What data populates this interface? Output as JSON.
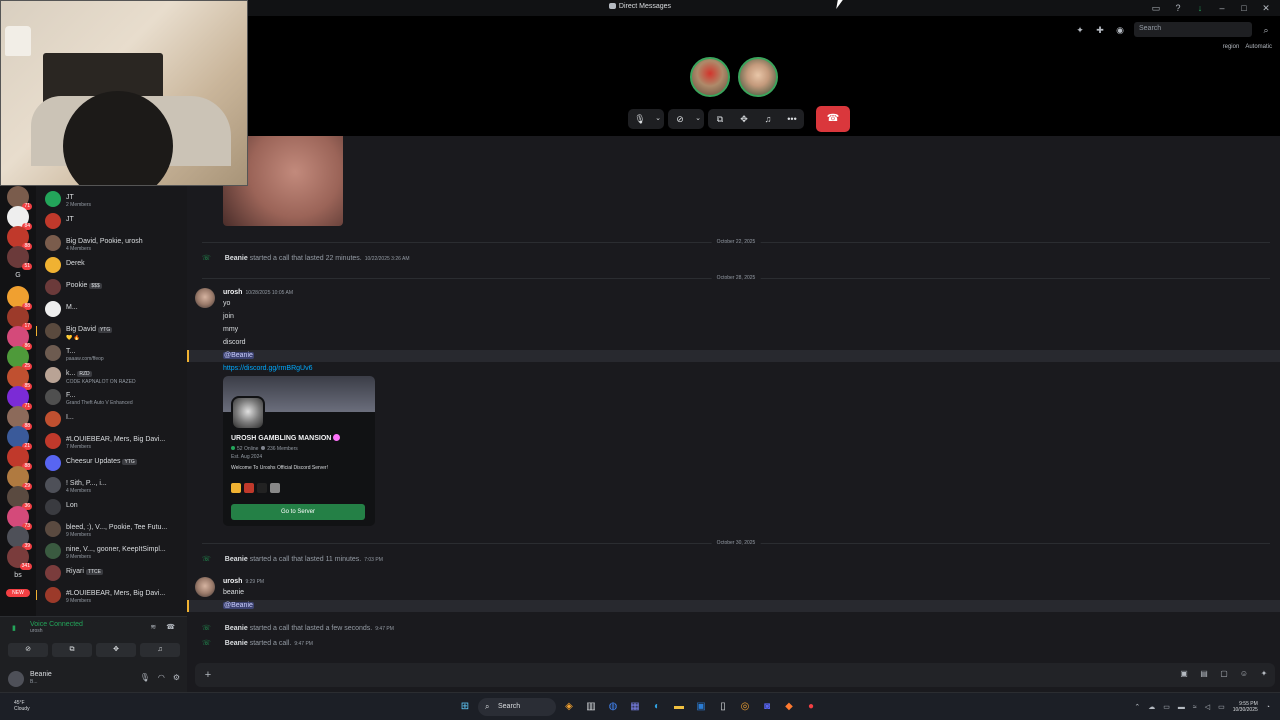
{
  "window": {
    "title": "Direct Messages",
    "search_placeholder": "Search",
    "region_label": "region",
    "region_value": "Automatic"
  },
  "call": {
    "controls": [
      "microphone-icon",
      "chevron-down-icon",
      "camera-off-icon",
      "chevron-down-icon",
      "screen-share-icon",
      "activity-icon",
      "soundboard-icon",
      "more-icon"
    ],
    "end_icon": "phone-hangup-icon"
  },
  "rail": {
    "badges": [
      "71",
      "84",
      "88",
      "51",
      "88",
      "17",
      "86",
      "25",
      "85",
      "71",
      "88",
      "21",
      "88",
      "29",
      "36",
      "73",
      "39",
      "341",
      "81"
    ],
    "letter_items": [
      "G",
      "bs"
    ],
    "new_label": "NEW"
  },
  "dms": [
    {
      "name": "JT",
      "sub": "2 Members",
      "color": "#23a55a"
    },
    {
      "name": "JT",
      "sub": "",
      "color": "#c0392b"
    },
    {
      "name": "Big David, Pookie, urosh",
      "sub": "4 Members",
      "color": "#7a5c4c"
    },
    {
      "name": "Derek",
      "sub": "",
      "color": "#f0b232"
    },
    {
      "name": "Pookie",
      "sub": "",
      "tag": "$$$",
      "color": "#6b3a3a"
    },
    {
      "name": "M...",
      "sub": "",
      "color": "#eeeeee"
    },
    {
      "name": "Big David",
      "sub": "💛 🔥",
      "tag": "YTG",
      "color": "#5a4a3e",
      "unread": true
    },
    {
      "name": "T...",
      "sub": "paaaw.com/ffeop",
      "color": "#6d5b50"
    },
    {
      "name": "k...",
      "sub": "CODE KAPNALOT ON RAZED",
      "tag": "RZD",
      "color": "#b9a395"
    },
    {
      "name": "F...",
      "sub": "Grand Theft Auto V Enhanced",
      "color": "#4f4f4f"
    },
    {
      "name": "I...",
      "sub": "",
      "color": "#c05030"
    },
    {
      "name": "#LOUIEBEAR, Mers, Big Davi...",
      "sub": "7 Members",
      "color": "#c0392b"
    },
    {
      "name": "Cheesur Updates",
      "sub": "",
      "tag": "YTG",
      "color": "#5865f2"
    },
    {
      "name": "! Sith, P..., i...",
      "sub": "4 Members",
      "color": "#4e5058"
    },
    {
      "name": "Lon",
      "sub": "",
      "color": "#3a3b40"
    },
    {
      "name": "bleed, :), V..., Pookie, Tee Futu...",
      "sub": "9 Members",
      "color": "#5a4a40"
    },
    {
      "name": "nine, V..., gooner, KeepItSimpl...",
      "sub": "9 Members",
      "color": "#3a5a40"
    },
    {
      "name": "Riyari",
      "sub": "",
      "tag": "TTCE",
      "color": "#7a3c3c"
    },
    {
      "name": "#LOUIEBEAR, Mers, Big Davi...",
      "sub": "9 Members",
      "color": "#9c3a2a",
      "unread": true
    }
  ],
  "voice": {
    "status": "Voice Connected",
    "channel": "urosh"
  },
  "voice_buttons": [
    "camera-off-icon",
    "screen-share-icon",
    "activity-icon",
    "soundboard-icon"
  ],
  "user": {
    "name": "Beanie",
    "status": "B..."
  },
  "messages": {
    "date1": "October 22, 2025",
    "call1": {
      "user": "Beanie",
      "text": "started a call that lasted 22 minutes.",
      "ts": "10/22/2025 3:26 AM"
    },
    "date2": "October 28, 2025",
    "m1": {
      "user": "urosh",
      "ts": "10/28/2025 10:05 AM",
      "lines": [
        "yo",
        "join",
        "mmy",
        "discord"
      ],
      "mention": "@Beanie",
      "link": "https://discord.gg/rmBRgUv6"
    },
    "invite": {
      "name": "UROSH GAMBLING MANSION",
      "online": "52 Online",
      "members": "236 Members",
      "est": "Est. Aug 2024",
      "description": "Welcome To Uroshs Official Discord Server!",
      "button": "Go to Server"
    },
    "date3": "October 30, 2025",
    "call2": {
      "user": "Beanie",
      "text": "started a call that lasted 11 minutes.",
      "ts": "7:03 PM"
    },
    "m2": {
      "user": "urosh",
      "ts": "9:29 PM",
      "text": "beanie",
      "mention": "@Beanie"
    },
    "call3": {
      "user": "Beanie",
      "text": "started a call that lasted a few seconds.",
      "ts": "9:47 PM"
    },
    "call4": {
      "user": "Beanie",
      "text": "started a call.",
      "ts": "9:47 PM"
    }
  },
  "composer": {
    "placeholder": "",
    "tools": [
      "gift-icon",
      "gif-icon",
      "sticker-icon",
      "emoji-icon",
      "apps-icon"
    ]
  },
  "taskbar": {
    "weather_temp": "45°F",
    "weather_desc": "Cloudy",
    "search_label": "Search",
    "time": "9:55 PM",
    "date": "10/30/2025"
  }
}
